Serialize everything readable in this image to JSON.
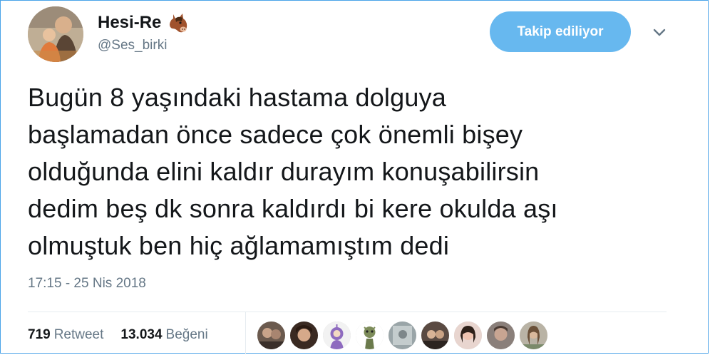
{
  "user": {
    "display_name": "Hesi-Re",
    "emoji_icon": "horse-face-icon",
    "handle": "@Ses_birki"
  },
  "follow_button": {
    "label": "Takip ediliyor"
  },
  "menu_icon": "chevron-down-icon",
  "tweet": {
    "lines": [
      "Bugün 8 yaşındaki hastama dolguya",
      "başlamadan önce sadece çok önemli bişey",
      "olduğunda elini kaldır durayım konuşabilirsin",
      "dedim beş dk sonra kaldırdı bi kere okulda aşı",
      "olmuştuk ben hiç ağlamamıştım dedi"
    ],
    "timestamp": "17:15 - 25 Nis 2018"
  },
  "stats": {
    "retweets_count": "719",
    "retweets_label": "Retweet",
    "likes_count": "13.034",
    "likes_label": "Beğeni"
  },
  "colors": {
    "accent": "#67b8ef",
    "border": "#4aa3e8",
    "text": "#14171a",
    "secondary": "#657786"
  }
}
